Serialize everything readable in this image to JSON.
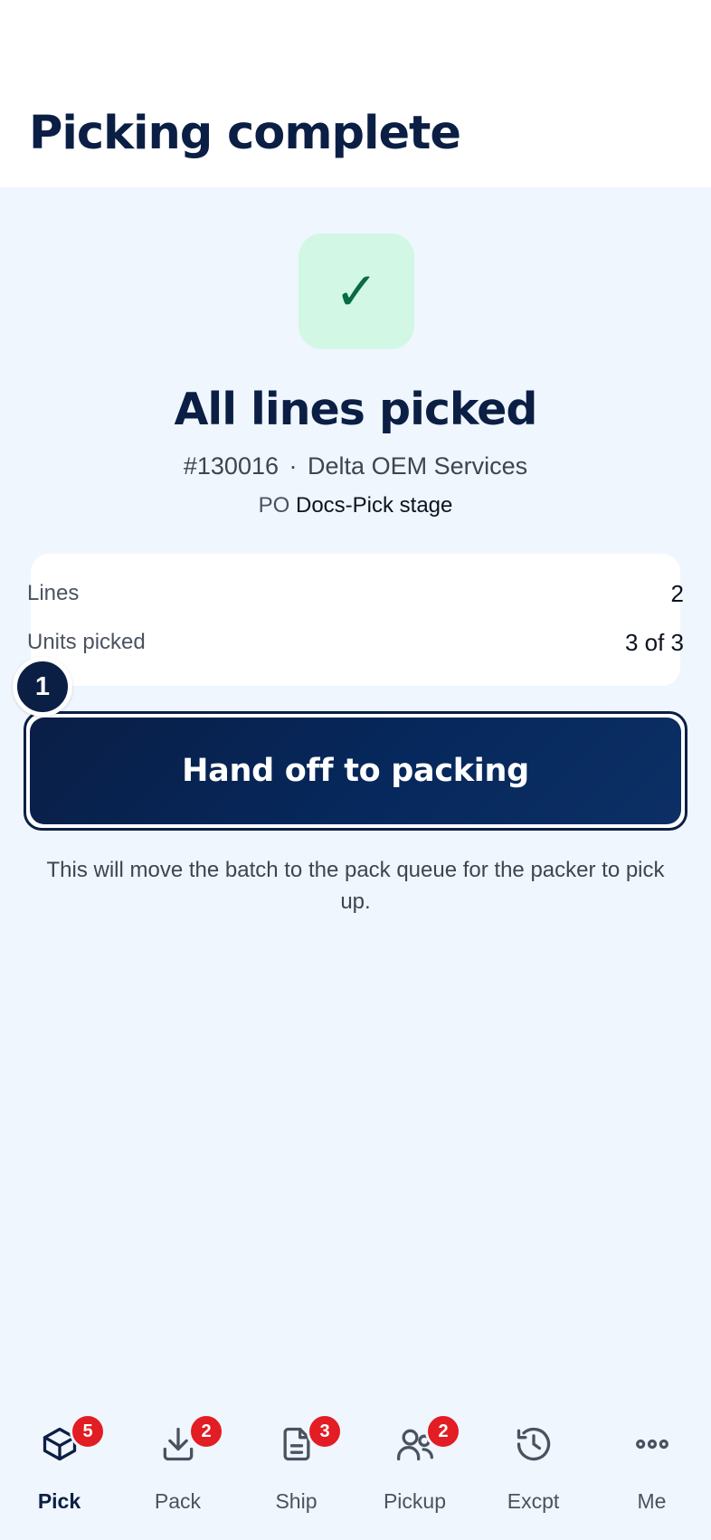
{
  "header": {
    "title": "Picking complete"
  },
  "status": {
    "icon": "check-icon",
    "glyph": "✓",
    "headline": "All lines picked",
    "order_number": "#130016",
    "separator": "·",
    "customer": "Delta OEM Services",
    "po_label": "PO",
    "po_value": "Docs-Pick stage"
  },
  "summary": {
    "rows": [
      {
        "label": "Lines",
        "value": "2"
      },
      {
        "label": "Units picked",
        "value": "3 of 3"
      }
    ]
  },
  "step_badge": "1",
  "primary_action": {
    "label": "Hand off to packing"
  },
  "help_text": "This will move the batch to the pack queue for the packer to pick up.",
  "tabs": [
    {
      "label": "Pick",
      "icon": "box-icon",
      "badge": "5",
      "active": true
    },
    {
      "label": "Pack",
      "icon": "download-icon",
      "badge": "2",
      "active": false
    },
    {
      "label": "Ship",
      "icon": "document-icon",
      "badge": "3",
      "active": false
    },
    {
      "label": "Pickup",
      "icon": "users-icon",
      "badge": "2",
      "active": false
    },
    {
      "label": "Excpt",
      "icon": "history-icon",
      "badge": "",
      "active": false
    },
    {
      "label": "Me",
      "icon": "more-icon",
      "badge": "",
      "active": false
    }
  ],
  "colors": {
    "brand_navy": "#0b1f45",
    "success_bg": "#d2f7e4",
    "success_fg": "#0a6a46",
    "badge_red": "#e21d23",
    "page_bg": "#eff6fd"
  }
}
